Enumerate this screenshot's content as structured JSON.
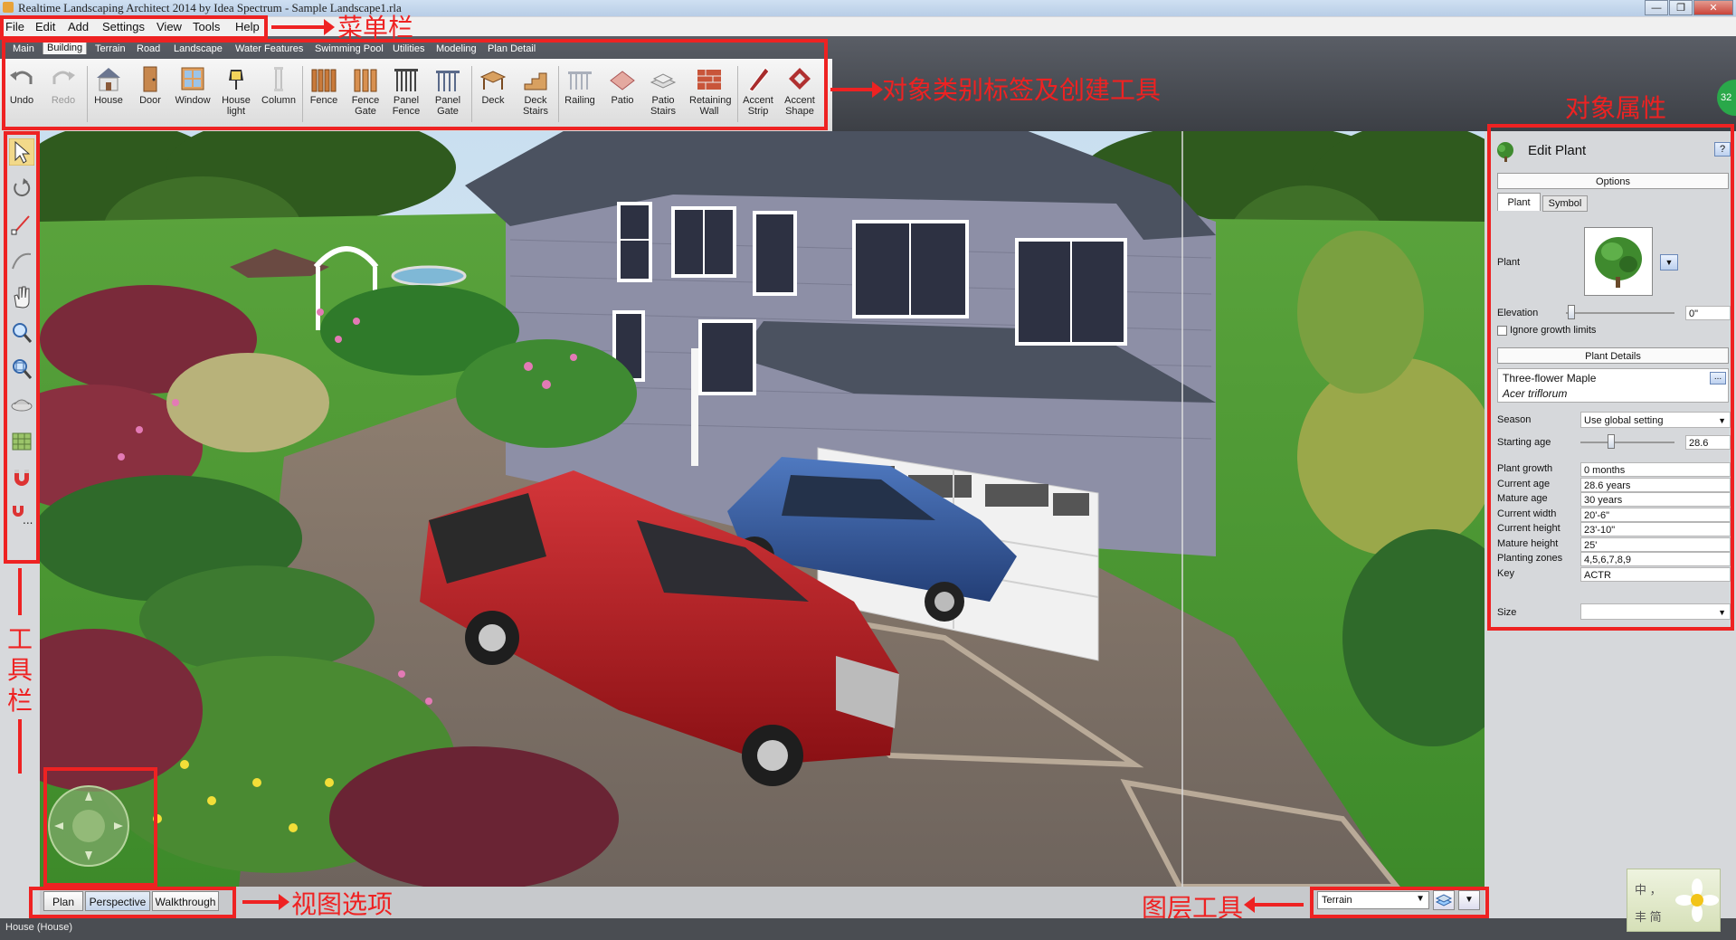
{
  "window": {
    "title": "Realtime Landscaping Architect 2014 by Idea Spectrum - Sample Landscape1.rla",
    "controls": {
      "minimize": "—",
      "maximize": "❐",
      "close": "✕"
    }
  },
  "menu": {
    "items": [
      "File",
      "Edit",
      "Add",
      "Settings",
      "View",
      "Tools",
      "Help"
    ]
  },
  "ribbon": {
    "tabs": [
      "Main",
      "Building",
      "Terrain",
      "Road",
      "Landscape",
      "Water Features",
      "Swimming Pool",
      "Utilities",
      "Modeling",
      "Plan Detail"
    ],
    "active_tab": "Building",
    "tools": [
      {
        "label": "Undo",
        "icon": "undo-icon",
        "disabled": false
      },
      {
        "label": "Redo",
        "icon": "redo-icon",
        "disabled": true
      },
      {
        "label": "House",
        "icon": "house-icon"
      },
      {
        "label": "Door",
        "icon": "door-icon"
      },
      {
        "label": "Window",
        "icon": "window-icon"
      },
      {
        "label": "House light",
        "icon": "lamp-icon"
      },
      {
        "label": "Column",
        "icon": "column-icon"
      },
      {
        "label": "Fence",
        "icon": "fence-icon"
      },
      {
        "label": "Fence Gate",
        "icon": "fence-gate-icon"
      },
      {
        "label": "Panel Fence",
        "icon": "panel-fence-icon"
      },
      {
        "label": "Panel Gate",
        "icon": "panel-gate-icon"
      },
      {
        "label": "Deck",
        "icon": "deck-icon"
      },
      {
        "label": "Deck Stairs",
        "icon": "deck-stairs-icon"
      },
      {
        "label": "Railing",
        "icon": "railing-icon"
      },
      {
        "label": "Patio",
        "icon": "patio-icon"
      },
      {
        "label": "Patio Stairs",
        "icon": "patio-stairs-icon"
      },
      {
        "label": "Retaining Wall",
        "icon": "retaining-wall-icon"
      },
      {
        "label": "Accent Strip",
        "icon": "accent-strip-icon"
      },
      {
        "label": "Accent Shape",
        "icon": "accent-shape-icon"
      }
    ]
  },
  "left_toolbar": {
    "tools": [
      "select-arrow-icon",
      "rotate-icon",
      "line-icon",
      "arc-icon",
      "hand-pan-icon",
      "zoom-in-icon",
      "zoom-region-icon",
      "orbit-icon",
      "grid-icon",
      "magnet-icon",
      "more-magnet-icon"
    ]
  },
  "annotations": {
    "menu": "菜单栏",
    "ribbon": "对象类别标签及创建工具",
    "properties": "对象属性",
    "toolbar": "工具栏",
    "view": "视图选项",
    "layer": "图层工具"
  },
  "view_options": {
    "buttons": [
      "Plan",
      "Perspective",
      "Walkthrough"
    ]
  },
  "layer_tool": {
    "selected": "Terrain"
  },
  "fps_badge": "32",
  "edit_panel": {
    "title": "Edit Plant",
    "help": "?",
    "options_header": "Options",
    "tabs": [
      "Plant",
      "Symbol"
    ],
    "plant_label": "Plant",
    "elevation_label": "Elevation",
    "elevation_value": "0\"",
    "elevation_slider": 0.05,
    "ignore_growth": "Ignore growth limits",
    "details_header": "Plant Details",
    "common_name": "Three-flower Maple",
    "latin_name": "Acer triflorum",
    "more": "...",
    "season_label": "Season",
    "season_value": "Use global setting",
    "starting_age_label": "Starting age",
    "starting_age_value": "28.6",
    "starting_age_slider": 0.33,
    "rows": [
      {
        "label": "Plant growth",
        "value": "0 months"
      },
      {
        "label": "Current age",
        "value": "28.6 years"
      },
      {
        "label": "Mature age",
        "value": "30 years"
      },
      {
        "label": "Current width",
        "value": "20'-6\""
      },
      {
        "label": "Current height",
        "value": "23'-10\""
      },
      {
        "label": "Mature height",
        "value": "25'"
      },
      {
        "label": "Planting zones",
        "value": "4,5,6,7,8,9"
      },
      {
        "label": "Key",
        "value": "ACTR"
      }
    ],
    "size_label": "Size",
    "size_value": ""
  },
  "status": {
    "text": "House (House)"
  },
  "ime": {
    "line1": "中 ，",
    "line2": "丰 简"
  },
  "colors": {
    "annotation": "#ee2222",
    "ribbon_dark": "#3c3f45",
    "panel": "#d6d8db"
  }
}
